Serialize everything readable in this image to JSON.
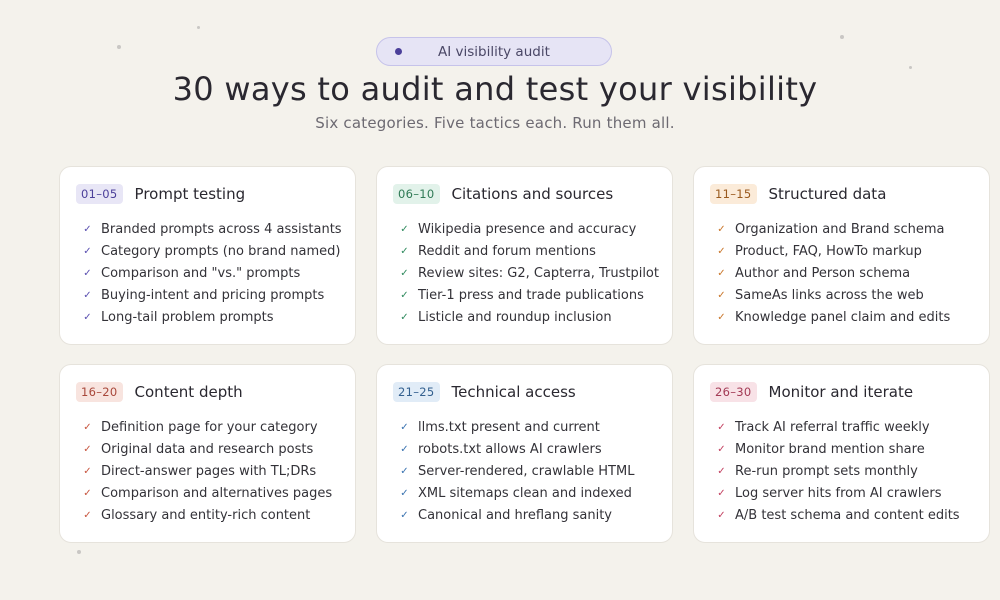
{
  "header": {
    "pill_label": "AI visibility audit",
    "title": "30 ways to audit and test your visibility",
    "subtitle": "Six categories. Five tactics each. Run them all."
  },
  "cards": [
    {
      "range": "01–05",
      "title": "Prompt testing",
      "badge_bg": "#e8e6f6",
      "badge_fg": "#4b3f9a",
      "check_color": "#5a4fb0",
      "items": [
        "Branded prompts across 4 assistants",
        "Category prompts (no brand named)",
        "Comparison and \"vs.\" prompts",
        "Buying-intent and pricing prompts",
        "Long-tail problem prompts"
      ]
    },
    {
      "range": "06–10",
      "title": "Citations and sources",
      "badge_bg": "#e2f2ea",
      "badge_fg": "#2f7a55",
      "check_color": "#2f8a5e",
      "items": [
        "Wikipedia presence and accuracy",
        "Reddit and forum mentions",
        "Review sites: G2, Capterra, Trustpilot",
        "Tier-1 press and trade publications",
        "Listicle and roundup inclusion"
      ]
    },
    {
      "range": "11–15",
      "title": "Structured data",
      "badge_bg": "#fbebd9",
      "badge_fg": "#9a5a1e",
      "check_color": "#c9762a",
      "items": [
        "Organization and Brand schema",
        "Product, FAQ, HowTo markup",
        "Author and Person schema",
        "SameAs links across the web",
        "Knowledge panel claim and edits"
      ]
    },
    {
      "range": "16–20",
      "title": "Content depth",
      "badge_bg": "#f8e4df",
      "badge_fg": "#a8473a",
      "check_color": "#c8553f",
      "items": [
        "Definition page for your category",
        "Original data and research posts",
        "Direct-answer pages with TL;DRs",
        "Comparison and alternatives pages",
        "Glossary and entity-rich content"
      ]
    },
    {
      "range": "21–25",
      "title": "Technical access",
      "badge_bg": "#e1ecf7",
      "badge_fg": "#33608f",
      "check_color": "#3a73b0",
      "items": [
        "llms.txt present and current",
        "robots.txt allows AI crawlers",
        "Server-rendered, crawlable HTML",
        "XML sitemaps clean and indexed",
        "Canonical and hreflang sanity"
      ]
    },
    {
      "range": "26–30",
      "title": "Monitor and iterate",
      "badge_bg": "#f8e2e7",
      "badge_fg": "#a33a55",
      "check_color": "#c24060",
      "items": [
        "Track AI referral traffic weekly",
        "Monitor brand mention share",
        "Re-run prompt sets monthly",
        "Log server hits from AI crawlers",
        "A/B test schema and content edits"
      ]
    }
  ]
}
